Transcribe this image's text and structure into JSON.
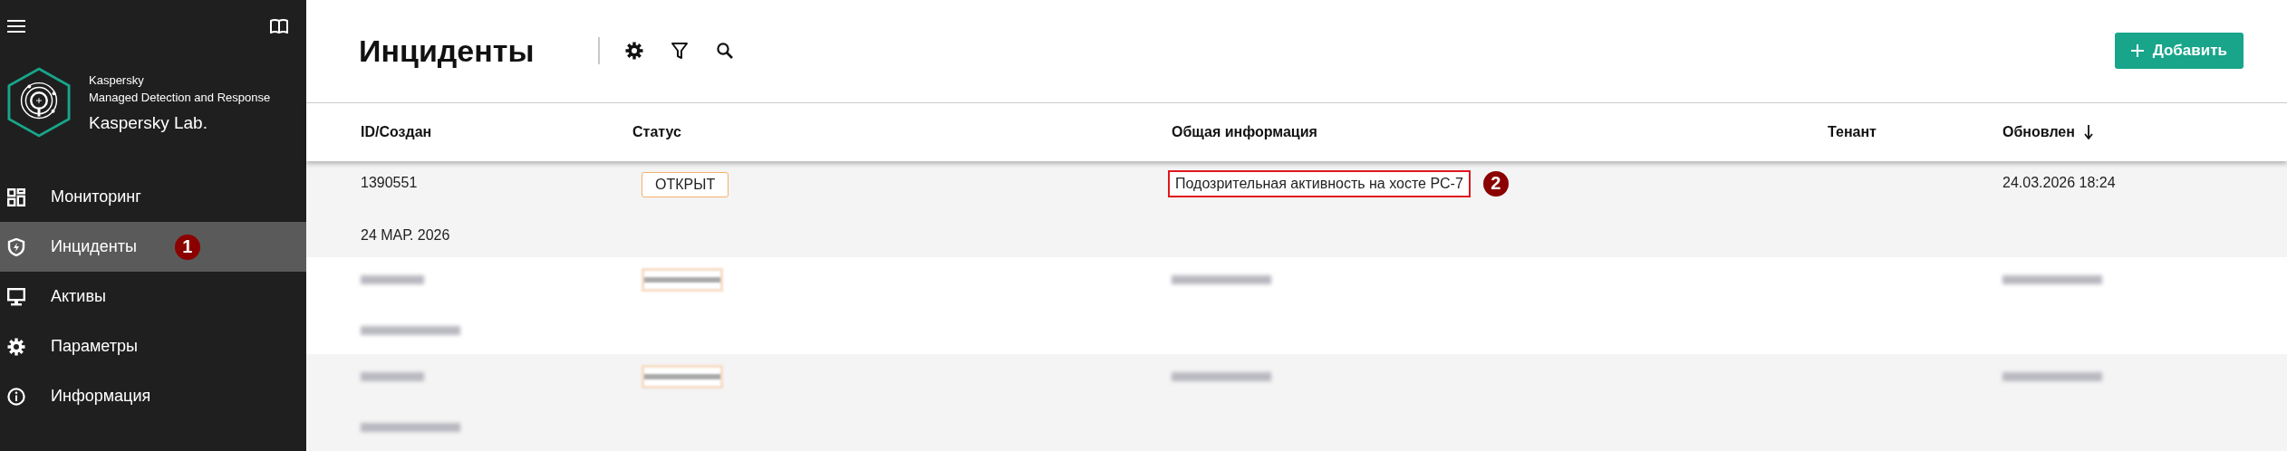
{
  "sidebar": {
    "product": {
      "vendor": "Kaspersky",
      "name": "Managed Detection and Response",
      "company": "Kaspersky Lab."
    },
    "items": [
      {
        "label": "Мониторинг",
        "selected": false
      },
      {
        "label": "Инциденты",
        "selected": true,
        "callout": "1"
      },
      {
        "label": "Активы",
        "selected": false
      },
      {
        "label": "Параметры",
        "selected": false
      },
      {
        "label": "Информация",
        "selected": false
      }
    ]
  },
  "page": {
    "title": "Инциденты",
    "add_button": "Добавить"
  },
  "table": {
    "columns": [
      {
        "label": "ID/Создан",
        "sorted": false
      },
      {
        "label": "Статус",
        "sorted": false
      },
      {
        "label": "Общая информация",
        "sorted": false
      },
      {
        "label": "Тенант",
        "sorted": false
      },
      {
        "label": "Обновлен",
        "sorted": true
      }
    ],
    "rows": [
      {
        "kind": "incident",
        "id": "1390551",
        "created": "24 МАР. 2026",
        "status": "ОТКРЫТ",
        "summary": "Подозрительная активность на хосте PC-7",
        "summary_highlighted": true,
        "callout": "2",
        "updated": "24.03.2026 18:24"
      },
      {
        "kind": "redacted"
      },
      {
        "kind": "redacted"
      }
    ]
  }
}
